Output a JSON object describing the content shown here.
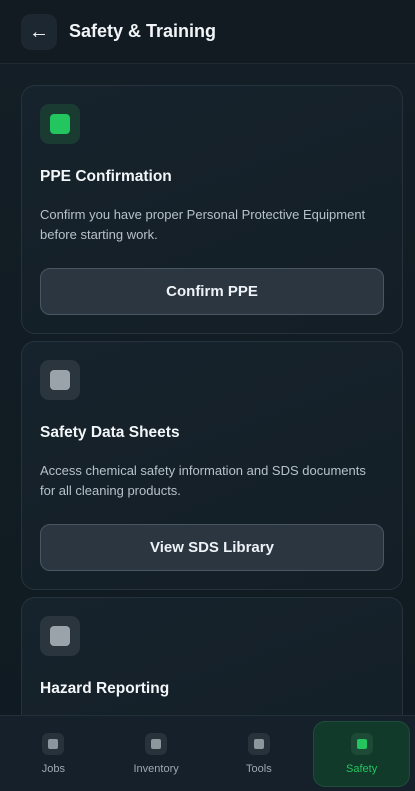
{
  "header": {
    "back_icon": "←",
    "title": "Safety & Training"
  },
  "cards": [
    {
      "icon": "ppe-icon",
      "icon_color": "#22c55e",
      "title": "PPE Confirmation",
      "description": "Confirm you have proper Personal Protective Equipment before starting work.",
      "button": "Confirm PPE"
    },
    {
      "icon": "document-icon",
      "icon_color": "#9aa3aa",
      "title": "Safety Data Sheets",
      "description": "Access chemical safety information and SDS documents for all cleaning products.",
      "button": "View SDS Library"
    },
    {
      "icon": "warning-icon",
      "icon_color": "#9aa3aa",
      "title": "Hazard Reporting"
    }
  ],
  "nav": {
    "items": [
      {
        "label": "Jobs",
        "active": false
      },
      {
        "label": "Inventory",
        "active": false
      },
      {
        "label": "Tools",
        "active": false
      },
      {
        "label": "Safety",
        "active": true
      }
    ]
  },
  "colors": {
    "accent": "#22c55e",
    "background": "#111a21"
  }
}
